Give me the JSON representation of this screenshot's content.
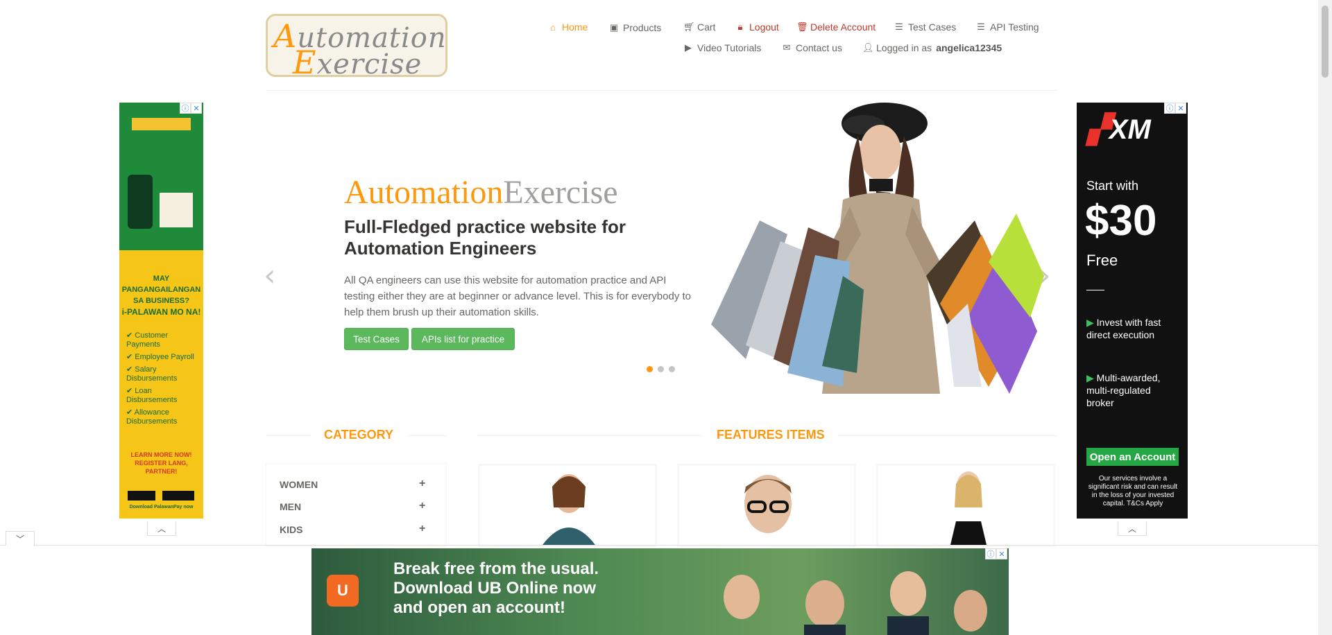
{
  "header": {
    "logo_word1_cap": "A",
    "logo_word1_rest": "utomation",
    "logo_word2_cap": "E",
    "logo_word2_rest": "xercise",
    "nav": {
      "home": "Home",
      "products": "Products",
      "cart": "Cart",
      "logout": "Logout",
      "delete_account": "Delete Account",
      "test_cases": "Test Cases",
      "api_testing": "API Testing",
      "video_tutorials": "Video Tutorials",
      "contact_us": "Contact us",
      "logged_in_prefix": "Logged in as",
      "username": "angelica12345"
    }
  },
  "slider": {
    "brand_part1": "Automation",
    "brand_part2": "Exercise",
    "headline": "Full-Fledged practice website for Automation Engineers",
    "description": "All QA engineers can use this website for automation practice and API testing either they are at beginner or advance level. This is for everybody to help them brush up their automation skills.",
    "btn_test_cases": "Test Cases",
    "btn_apis": "APIs list for practice",
    "active_slide": 1,
    "slide_count": 3
  },
  "sections": {
    "category_title": "Category",
    "features_title": "Features Items",
    "categories": [
      "WOMEN",
      "MEN",
      "KIDS"
    ]
  },
  "ads": {
    "left": {
      "line1": "MAY",
      "line2": "PANGANGAILANGAN",
      "line3": "SA BUSINESS?",
      "line4": "i-PALAWAN MO NA!",
      "items": [
        "Customer Payments",
        "Employee Payroll",
        "Salary Disbursements",
        "Loan Disbursements",
        "Allowance Disbursements"
      ],
      "learn_more": "LEARN MORE NOW!",
      "register": "REGISTER LANG, PARTNER!",
      "download": "Download PalawanPay now"
    },
    "right": {
      "brand": "XM",
      "start_with": "Start with",
      "amount": "$30",
      "free": "Free",
      "bullet1": "Invest with fast direct execution",
      "bullet2": "Multi-awarded, multi-regulated broker",
      "cta": "Open an Account",
      "disclaimer": "Our services involve a significant risk and can result in the loss of your invested capital. T&Cs Apply"
    },
    "bottom": {
      "line1": "Break free from the usual.",
      "line2": "Download UB Online now",
      "line3": "and open an account!"
    }
  },
  "colors": {
    "accent": "#fe980f",
    "button_green": "#5cb85c",
    "logout_red": "#c0392b"
  }
}
